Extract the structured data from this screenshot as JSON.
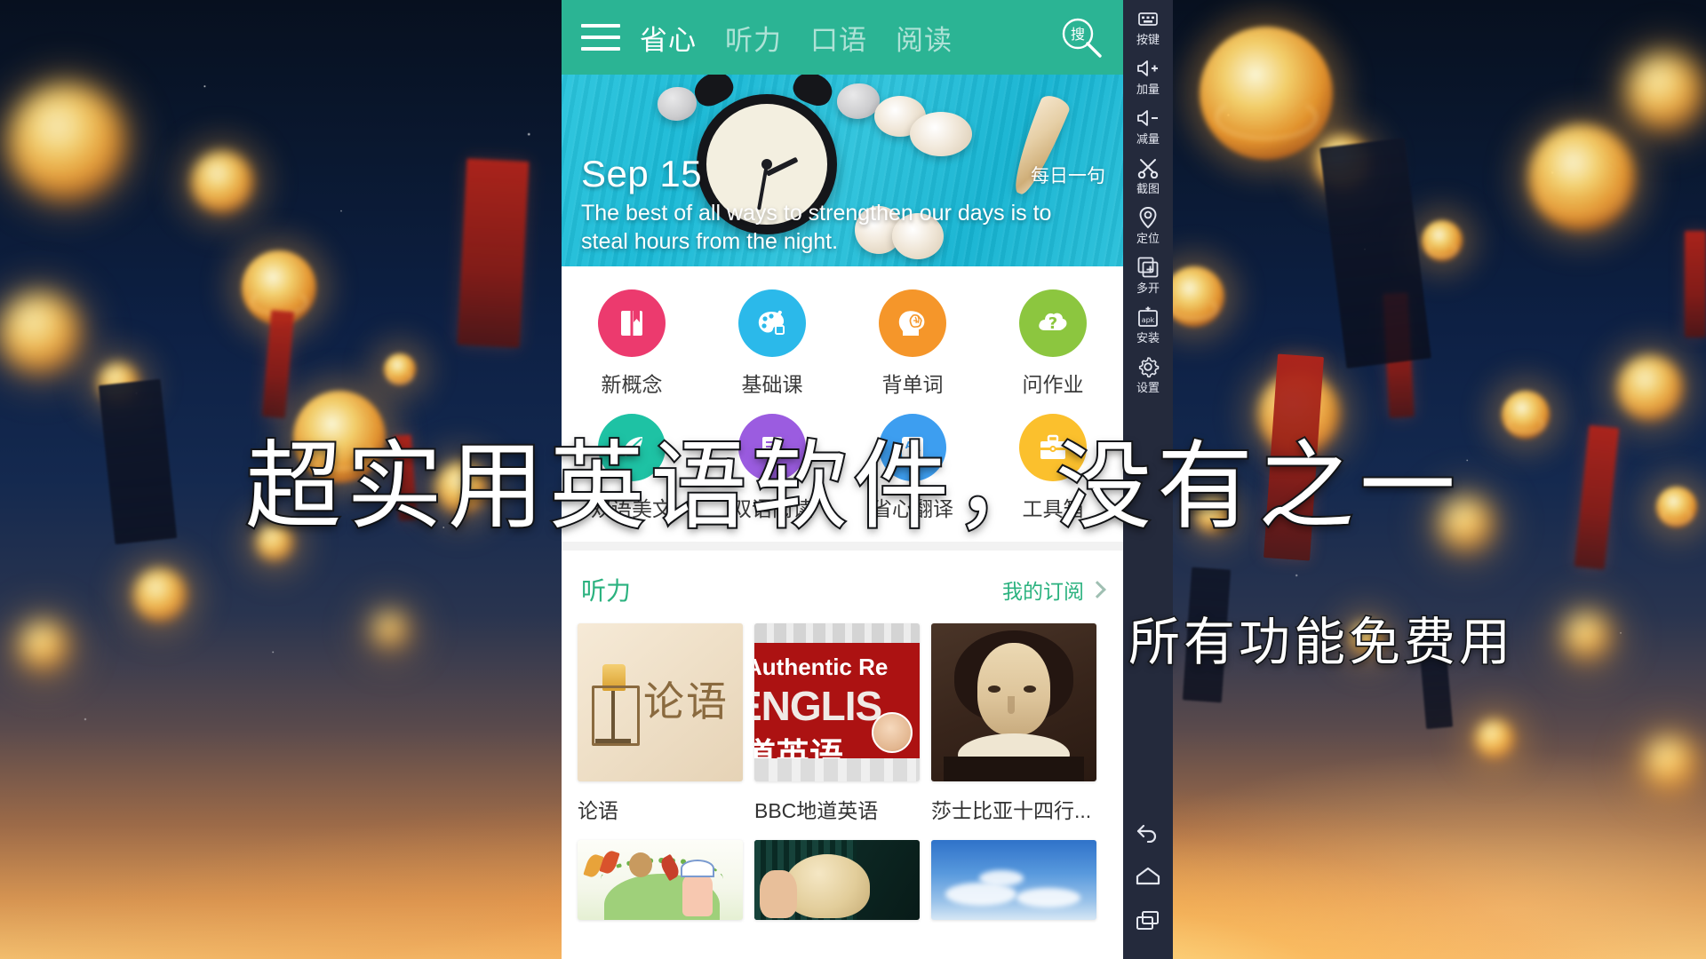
{
  "app": {
    "header": {
      "menu_icon": "hamburger-menu-icon",
      "tabs": [
        {
          "label": "省心",
          "active": true
        },
        {
          "label": "听力",
          "active": false
        },
        {
          "label": "口语",
          "active": false
        },
        {
          "label": "阅读",
          "active": false
        }
      ],
      "search": {
        "icon": "search-magnifier-icon",
        "label": "搜"
      },
      "bar_color": "#2bb494"
    },
    "banner": {
      "date": "Sep 15",
      "quote": "The best of all ways to strengthen our days is to steal hours from the night.",
      "tag": "每日一句",
      "bg_color": "#1fbcd6"
    },
    "grid": {
      "rows": [
        [
          {
            "label": "新概念",
            "icon": "book-icon",
            "color": "#ec3a6e"
          },
          {
            "label": "基础课",
            "icon": "palette-brush-icon",
            "color": "#2bb9ea"
          },
          {
            "label": "背单词",
            "icon": "head-brain-icon",
            "color": "#f5962a"
          },
          {
            "label": "问作业",
            "icon": "cloud-question-icon",
            "color": "#8cc63f"
          }
        ],
        [
          {
            "label": "双语美文",
            "icon": "leaf-article-icon",
            "color": "#1ec2a4"
          },
          {
            "label": "双语阅读",
            "icon": "book-reading-icon",
            "color": "#9b5ce0"
          },
          {
            "label": "省心翻译",
            "icon": "translate-a-icon",
            "color": "#3d9ef0"
          },
          {
            "label": "工具箱",
            "icon": "toolbox-icon",
            "color": "#fbc02d"
          }
        ]
      ]
    },
    "listening": {
      "title": "听力",
      "more_label": "我的订阅",
      "more_icon": "chevron-right-icon",
      "cards": [
        {
          "title": "论语",
          "thumb": "lunyu-scroll-thumbnail"
        },
        {
          "title": "BBC地道英语",
          "thumb": "authentic-real-english-thumbnail",
          "thumb_text": {
            "line1": "Authentic Re",
            "line2": "ENGLIS",
            "line3": "道英语"
          }
        },
        {
          "title": "莎士比亚十四行...",
          "thumb": "shakespeare-portrait-thumbnail"
        }
      ],
      "cards_row2": [
        {
          "thumb": "cartoon-autumn-thumbnail"
        },
        {
          "thumb": "person-blinds-thumbnail"
        },
        {
          "thumb": "blue-sky-thumbnail"
        }
      ]
    }
  },
  "emulator_toolbar": {
    "items": [
      {
        "label": "按键",
        "icon": "keyboard-keys-icon"
      },
      {
        "label": "加量",
        "icon": "volume-up-icon"
      },
      {
        "label": "减量",
        "icon": "volume-down-icon"
      },
      {
        "label": "截图",
        "icon": "scissors-screenshot-icon"
      },
      {
        "label": "定位",
        "icon": "location-pin-icon"
      },
      {
        "label": "多开",
        "icon": "multi-instance-icon"
      },
      {
        "label": "安装",
        "icon": "apk-install-icon"
      },
      {
        "label": "设置",
        "icon": "gear-settings-icon"
      }
    ],
    "nav": [
      {
        "icon": "back-arrow-icon"
      },
      {
        "icon": "home-icon"
      },
      {
        "icon": "recents-icon"
      }
    ],
    "bg_color": "#242a3c"
  },
  "overlay": {
    "main_text": "超实用英语软件，没有之一",
    "sub_text": "所有功能免费用"
  }
}
